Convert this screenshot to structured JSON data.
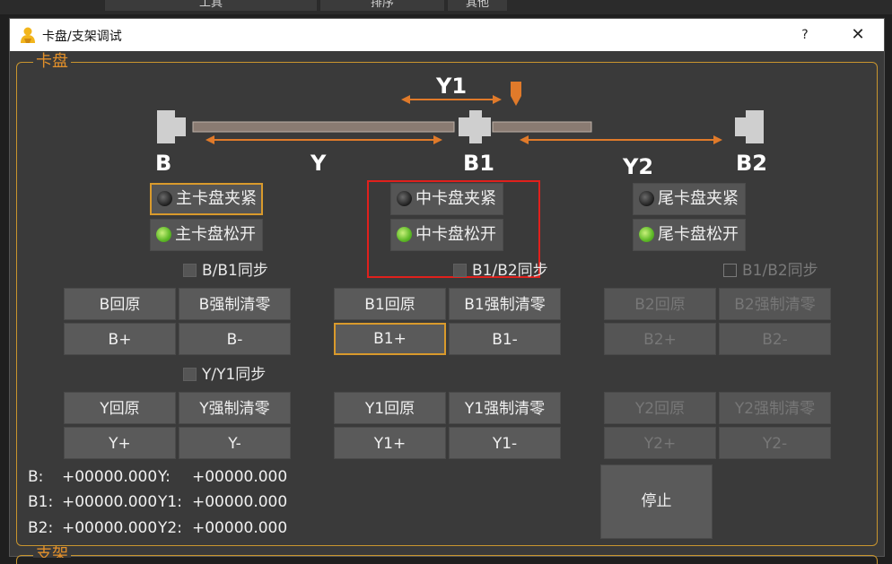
{
  "menu_tabs": [
    {
      "label": "工具"
    },
    {
      "label": "排序"
    },
    {
      "label": "其他"
    }
  ],
  "window": {
    "title": "卡盘/支架调试",
    "help": "?",
    "close": "✕"
  },
  "group_chuck": {
    "title": "卡盘"
  },
  "group_support": {
    "title": "支架"
  },
  "diagram": {
    "labels": {
      "B": "B",
      "B1": "B1",
      "B2": "B2",
      "Y": "Y",
      "Y1": "Y1",
      "Y2": "Y2"
    },
    "accent": "#e07a2a"
  },
  "clamps": {
    "main_clamp": "主卡盘夹紧",
    "main_release": "主卡盘松开",
    "mid_clamp": "中卡盘夹紧",
    "mid_release": "中卡盘松开",
    "tail_clamp": "尾卡盘夹紧",
    "tail_release": "尾卡盘松开"
  },
  "sync": {
    "b_b1": "B/B1同步",
    "b1_b2_a": "B1/B2同步",
    "b1_b2_b": "B1/B2同步",
    "y_y1": "Y/Y1同步"
  },
  "buttons": {
    "b_home": "B回原",
    "b_zero": "B强制清零",
    "b_plus": "B+",
    "b_minus": "B-",
    "b1_home": "B1回原",
    "b1_zero": "B1强制清零",
    "b1_plus": "B1+",
    "b1_minus": "B1-",
    "b2_home": "B2回原",
    "b2_zero": "B2强制清零",
    "b2_plus": "B2+",
    "b2_minus": "B2-",
    "y_home": "Y回原",
    "y_zero": "Y强制清零",
    "y_plus": "Y+",
    "y_minus": "Y-",
    "y1_home": "Y1回原",
    "y1_zero": "Y1强制清零",
    "y1_plus": "Y1+",
    "y1_minus": "Y1-",
    "y2_home": "Y2回原",
    "y2_zero": "Y2强制清零",
    "y2_plus": "Y2+",
    "y2_minus": "Y2-",
    "stop": "停止"
  },
  "positions": [
    {
      "axis1": "B:",
      "val1": "+00000.000",
      "axis2": "Y:",
      "val2": "+00000.000"
    },
    {
      "axis1": "B1:",
      "val1": "+00000.000",
      "axis2": "Y1:",
      "val2": "+00000.000"
    },
    {
      "axis1": "B2:",
      "val1": "+00000.000",
      "axis2": "Y2:",
      "val2": "+00000.000"
    }
  ]
}
